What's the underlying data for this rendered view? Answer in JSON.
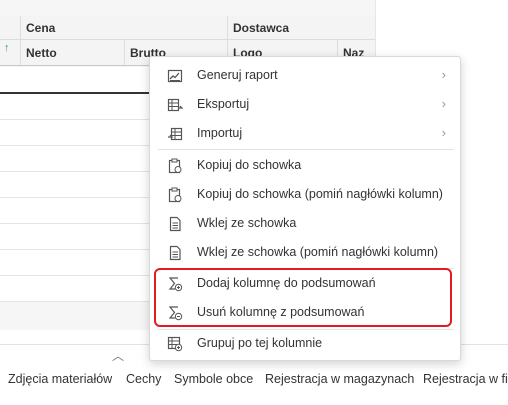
{
  "grid": {
    "group_headers": {
      "cena": "Cena",
      "dostawca": "Dostawca"
    },
    "column_headers": {
      "netto": "Netto",
      "brutto": "Brutto",
      "logo": "Logo",
      "naz": "Naz"
    },
    "sort_arrow": "↑",
    "expand_toggle": "︿"
  },
  "context_menu": {
    "items": [
      {
        "label": "Generuj raport",
        "icon": "report-icon",
        "submenu": true
      },
      {
        "label": "Eksportuj",
        "icon": "export-icon",
        "submenu": true
      },
      {
        "label": "Importuj",
        "icon": "import-icon",
        "submenu": true
      },
      {
        "label": "Kopiuj do schowka",
        "icon": "clipboard-copy-icon"
      },
      {
        "label": "Kopiuj do schowka (pomiń nagłówki kolumn)",
        "icon": "clipboard-copy-icon"
      },
      {
        "label": "Wklej ze schowka",
        "icon": "paste-icon"
      },
      {
        "label": "Wklej ze schowka (pomiń nagłówki kolumn)",
        "icon": "paste-icon"
      },
      {
        "label": "Dodaj kolumnę do podsumowań",
        "icon": "sum-add-icon"
      },
      {
        "label": "Usuń kolumnę z podsumowań",
        "icon": "sum-remove-icon"
      },
      {
        "label": "Grupuj po tej kolumnie",
        "icon": "group-icon"
      }
    ],
    "chevron": "›",
    "highlight_color": "#e11b22"
  },
  "tabs": [
    "Zdjęcia materiałów",
    "Cechy",
    "Symbole obce",
    "Rejestracja w magazynach",
    "Rejestracja w fir"
  ]
}
